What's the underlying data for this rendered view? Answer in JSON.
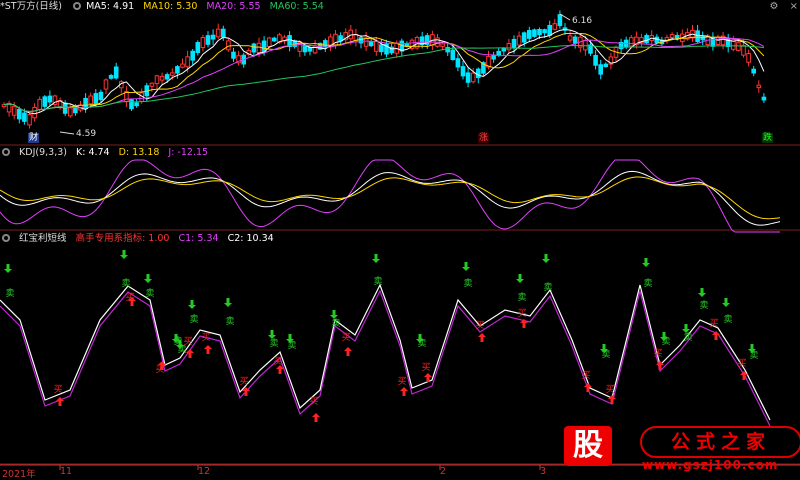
{
  "main": {
    "title": "*ST万方(日线)",
    "ma": [
      {
        "label": "MA5: 4.91",
        "color": "#ffffff"
      },
      {
        "label": "MA10: 5.30",
        "color": "#ffd700"
      },
      {
        "label": "MA20: 5.55",
        "color": "#e040fb"
      },
      {
        "label": "MA60: 5.54",
        "color": "#22c55e"
      }
    ],
    "high_label": "6.16",
    "low_label": "4.59",
    "badge_cai": "财",
    "badge_zhang": "涨",
    "badge_die": "跌"
  },
  "kdj": {
    "title": "KDJ(9,3,3)",
    "k": "K: 4.74",
    "d": "D: 13.18",
    "j": "J: -12.15"
  },
  "custom": {
    "title": "红宝利短线",
    "a": "高手专用系指标: 1.00",
    "c1": "C1: 5.34",
    "c2": "C2: 10.34"
  },
  "signals": {
    "buy": "买",
    "sell": "卖"
  },
  "xaxis": [
    {
      "label": "2021年"
    },
    {
      "label": "11"
    },
    {
      "label": "12"
    },
    {
      "label": "2"
    },
    {
      "label": "3"
    }
  ],
  "watermark": {
    "badge": "股",
    "title": "公式之家",
    "url": "www.gszj100.com"
  },
  "colors": {
    "up": "#ff3333",
    "down": "#00e5ff",
    "ma5": "#ffffff",
    "ma10": "#ffd700",
    "ma20": "#e040fb",
    "ma60": "#22c55e",
    "sell": "#22cc22",
    "buy": "#ff2222"
  },
  "icons": [
    "settings-icon",
    "close-icon"
  ]
}
